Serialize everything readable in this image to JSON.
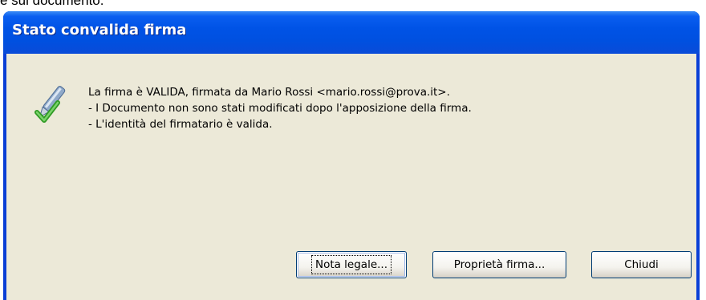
{
  "page": {
    "top_text": "e sul documento."
  },
  "dialog": {
    "title": "Stato convalida firma",
    "icon": "signature-valid-icon",
    "message_lines": [
      "La firma è VALIDA, firmata da Mario Rossi <mario.rossi@prova.it>.",
      "- I Documento non sono stati modificati dopo l'apposizione della firma.",
      "- L'identità del firmatario è valida."
    ],
    "buttons": {
      "legal_label": "Nota legale...",
      "properties_label": "Proprietà firma...",
      "close_label": "Chiudi"
    }
  },
  "colors": {
    "titlebar": "#0053e6",
    "client": "#ece9d8",
    "title_text": "#ffffff"
  }
}
